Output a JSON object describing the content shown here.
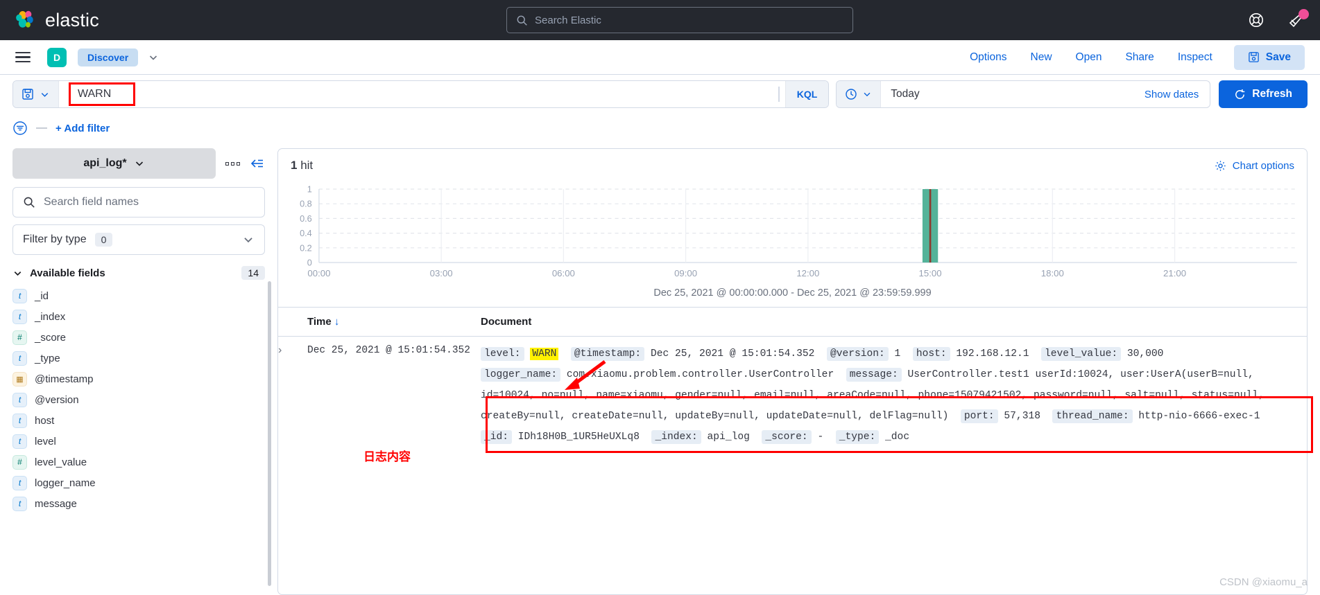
{
  "global_header": {
    "brand": "elastic",
    "search_placeholder": "Search Elastic",
    "icons": [
      "help-lifebuoy-icon",
      "news-megaphone-icon"
    ]
  },
  "appbar": {
    "menu_icon": "hamburger-menu-icon",
    "app_badge": "D",
    "app_tab": "Discover",
    "links": [
      "Options",
      "New",
      "Open",
      "Share",
      "Inspect"
    ],
    "save_label": "Save"
  },
  "querybar": {
    "saved_query_icon": "save-disk-icon",
    "query_value": "WARN",
    "language": "KQL",
    "date_value": "Today",
    "show_dates": "Show dates",
    "refresh_label": "Refresh"
  },
  "filterbar": {
    "filter_icon": "filter-settings-icon",
    "dash": "—",
    "add_filter": "+ Add filter"
  },
  "sidebar": {
    "index_pattern": "api_log*",
    "field_search_placeholder": "Search field names",
    "filter_by_type_label": "Filter by type",
    "filter_by_type_count": "0",
    "available_fields_label": "Available fields",
    "available_fields_count": "14",
    "fields": [
      {
        "name": "_id",
        "type": "t"
      },
      {
        "name": "_index",
        "type": "t"
      },
      {
        "name": "_score",
        "type": "#"
      },
      {
        "name": "_type",
        "type": "t"
      },
      {
        "name": "@timestamp",
        "type": "date"
      },
      {
        "name": "@version",
        "type": "t"
      },
      {
        "name": "host",
        "type": "t"
      },
      {
        "name": "level",
        "type": "t"
      },
      {
        "name": "level_value",
        "type": "#"
      },
      {
        "name": "logger_name",
        "type": "t"
      },
      {
        "name": "message",
        "type": "t"
      }
    ]
  },
  "content": {
    "hits_count": "1",
    "hits_label": "hit",
    "chart_options": "Chart options",
    "chart_caption": "Dec 25, 2021 @ 00:00:00.000 - Dec 25, 2021 @ 23:59:59.999",
    "columns": {
      "time": "Time",
      "sort_arrow": "↓",
      "document": "Document"
    },
    "row": {
      "time": "Dec 25, 2021 @ 15:01:54.352",
      "line1": [
        {
          "k": "level:",
          "v": "WARN",
          "highlight": true
        },
        {
          "k": "@timestamp:",
          "v": "Dec 25, 2021 @ 15:01:54.352"
        },
        {
          "k": "@version:",
          "v": "1"
        },
        {
          "k": "host:",
          "v": "192.168.12.1"
        },
        {
          "k": "level_value:",
          "v": "30,000"
        }
      ],
      "line2_key": "logger_name:",
      "line2_val": "com.xiaomu.problem.controller.UserController",
      "line2_key2": "message:",
      "line2_val2": "UserController.test1 userId:10024, user:UserA(userB=null,",
      "line3": "id=10024, no=null, name=xiaomu, gender=null, email=null, areaCode=null, phone=15079421502, password=null, salt=null, status=null,",
      "line4_text": "createBy=null, createDate=null, updateBy=null, updateDate=null, delFlag=null)",
      "line4_key1": "port:",
      "line4_val1": "57,318",
      "line4_key2": "thread_name:",
      "line4_val2": "http-nio-6666-exec-1",
      "line5": [
        {
          "k": "_id:",
          "v": "IDh18H0B_1UR5HeUXLq8"
        },
        {
          "k": "_index:",
          "v": "api_log"
        },
        {
          "k": "_score:",
          "v": "-"
        },
        {
          "k": "_type:",
          "v": "_doc"
        }
      ]
    }
  },
  "annotations": {
    "log_content_label": "日志内容",
    "accent_red": "#FF0000",
    "highlight_yellow": "#FFF200"
  },
  "watermark": "CSDN @xiaomu_a",
  "chart_data": {
    "type": "bar",
    "title": "",
    "xlabel": "",
    "ylabel": "",
    "categories": [
      "00:00",
      "03:00",
      "06:00",
      "09:00",
      "12:00",
      "15:00",
      "18:00",
      "21:00"
    ],
    "x_tick_labels": [
      "00:00",
      "03:00",
      "06:00",
      "09:00",
      "12:00",
      "15:00",
      "18:00",
      "21:00"
    ],
    "y_tick_labels": [
      "0",
      "0.2",
      "0.4",
      "0.6",
      "0.8",
      "1"
    ],
    "ylim": [
      0,
      1
    ],
    "values": [
      0,
      0,
      0,
      0,
      0,
      1,
      0,
      0
    ],
    "bar_color": "#54B399",
    "marker_color": "#8C3A2E",
    "marker_label": "15:00",
    "grid": true,
    "legend": "none"
  }
}
